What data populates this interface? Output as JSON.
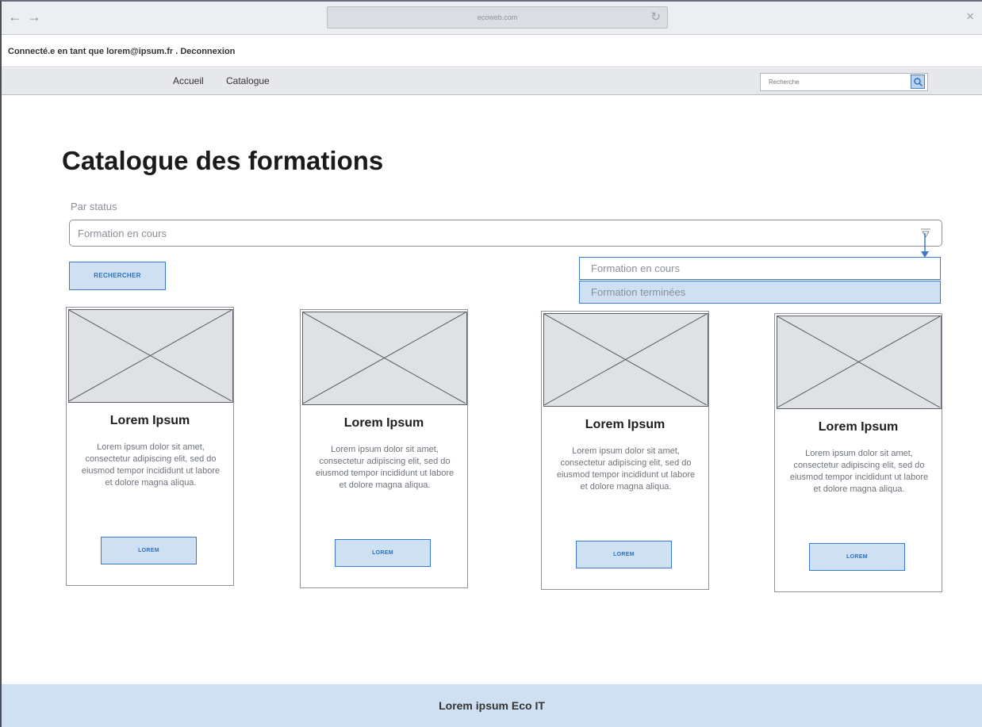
{
  "browser": {
    "back_glyph": "←",
    "forward_glyph": "→",
    "url": "ecoweb.com",
    "reload_glyph": "↻",
    "close_glyph": "×"
  },
  "userbar": {
    "text": "Connecté.e en tant que lorem@ipsum.fr . Deconnexion"
  },
  "nav": {
    "items": [
      {
        "label": "Accueil"
      },
      {
        "label": "Catalogue"
      }
    ],
    "search_placeholder": "Recherche"
  },
  "main": {
    "title": "Catalogue des formations",
    "filter": {
      "label": "Par status",
      "selected": "Formation en cours",
      "options": [
        {
          "label": "Formation en cours"
        },
        {
          "label": "Formation terminées"
        }
      ]
    },
    "search_button": "RECHERCHER"
  },
  "cards": [
    {
      "title": "Lorem Ipsum",
      "text": "Lorem ipsum dolor sit amet, consectetur adipiscing elit, sed do eiusmod tempor incididunt ut labore et dolore magna aliqua.",
      "button": "LOREM"
    },
    {
      "title": "Lorem Ipsum",
      "text": "Lorem ipsum dolor sit amet, consectetur adipiscing elit, sed do eiusmod tempor incididunt ut labore et dolore magna aliqua.",
      "button": "LOREM"
    },
    {
      "title": "Lorem Ipsum",
      "text": "Lorem ipsum dolor sit amet, consectetur adipiscing elit, sed do eiusmod tempor incididunt ut labore et dolore magna aliqua.",
      "button": "LOREM"
    },
    {
      "title": "Lorem Ipsum",
      "text": "Lorem ipsum dolor sit amet, consectetur adipiscing elit, sed do eiusmod tempor incididunt ut labore et dolore magna aliqua.",
      "button": "LOREM"
    }
  ],
  "footer": {
    "text": "Lorem ipsum Eco IT"
  },
  "colors": {
    "accent": "#3b7ac8",
    "accent_fill": "#cfe0f3",
    "placeholder_fill": "#dfe1e5"
  }
}
